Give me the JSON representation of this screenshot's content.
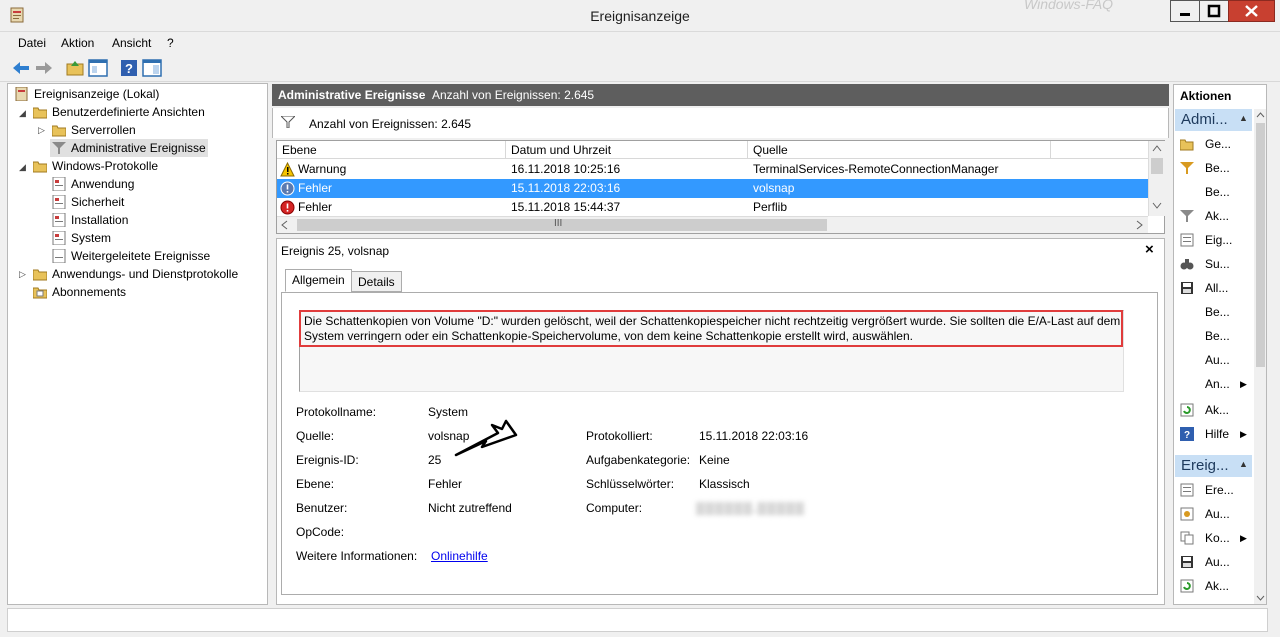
{
  "window": {
    "title": "Ereignisanzeige",
    "watermark": "Windows-FAQ"
  },
  "menu": [
    "Datei",
    "Aktion",
    "Ansicht",
    "?"
  ],
  "tree": [
    {
      "label": "Ereignisanzeige (Lokal)"
    },
    {
      "label": "Benutzerdefinierte Ansichten"
    },
    {
      "label": "Serverrollen"
    },
    {
      "label": "Administrative Ereignisse"
    },
    {
      "label": "Windows-Protokolle"
    },
    {
      "label": "Anwendung"
    },
    {
      "label": "Sicherheit"
    },
    {
      "label": "Installation"
    },
    {
      "label": "System"
    },
    {
      "label": "Weitergeleitete Ereignisse"
    },
    {
      "label": "Anwendungs- und Dienstprotokolle"
    },
    {
      "label": "Abonnements"
    }
  ],
  "main": {
    "header_title": "Administrative Ereignisse",
    "header_count": "Anzahl von Ereignissen: 2.645",
    "filter_text": "Anzahl von Ereignissen: 2.645",
    "columns": [
      "Ebene",
      "Datum und Uhrzeit",
      "Quelle"
    ],
    "rows": [
      {
        "level": "Warnung",
        "datetime": "16.11.2018 10:25:16",
        "source": "TerminalServices-RemoteConnectionManager"
      },
      {
        "level": "Fehler",
        "datetime": "15.11.2018 22:03:16",
        "source": "volsnap"
      },
      {
        "level": "Fehler",
        "datetime": "15.11.2018 15:44:37",
        "source": "Perflib"
      }
    ],
    "hscroll_grip": "III"
  },
  "detail": {
    "title": "Ereignis 25, volsnap",
    "close": "×",
    "tabs": [
      "Allgemein",
      "Details"
    ],
    "message": "Die Schattenkopien von Volume \"D:\" wurden gelöscht, weil der Schattenkopiespeicher nicht rechtzeitig vergrößert wurde. Sie sollten die E/A-Last auf dem System verringern oder ein Schattenkopie-Speichervolume, von dem keine Schattenkopie erstellt wird, auswählen.",
    "props": {
      "protokollname_label": "Protokollname:",
      "protokollname": "System",
      "quelle_label": "Quelle:",
      "quelle": "volsnap",
      "eventid_label": "Ereignis-ID:",
      "eventid": "25",
      "ebene_label": "Ebene:",
      "ebene": "Fehler",
      "benutzer_label": "Benutzer:",
      "benutzer": "Nicht zutreffend",
      "opcode_label": "OpCode:",
      "info_label": "Weitere Informationen:",
      "info_link": "Onlinehilfe",
      "protokolliert_label": "Protokolliert:",
      "protokolliert": "15.11.2018 22:03:16",
      "kategorie_label": "Aufgabenkategorie:",
      "kategorie": "Keine",
      "keywords_label": "Schlüsselwörter:",
      "keywords": "Klassisch",
      "computer_label": "Computer:",
      "computer": "▒▒▒▒▒▒.▒▒▒▒▒"
    }
  },
  "actions": {
    "title": "Aktionen",
    "section1": "Admi...",
    "items1": [
      "Ge...",
      "Be...",
      "Be...",
      "Ak...",
      "Eig...",
      "Su...",
      "All...",
      "Be...",
      "Be...",
      "Au...",
      "An...",
      "Ak...",
      "Hilfe"
    ],
    "section2": "Ereig...",
    "items2": [
      "Ere...",
      "Au...",
      "Ko...",
      "Au...",
      "Ak..."
    ]
  }
}
